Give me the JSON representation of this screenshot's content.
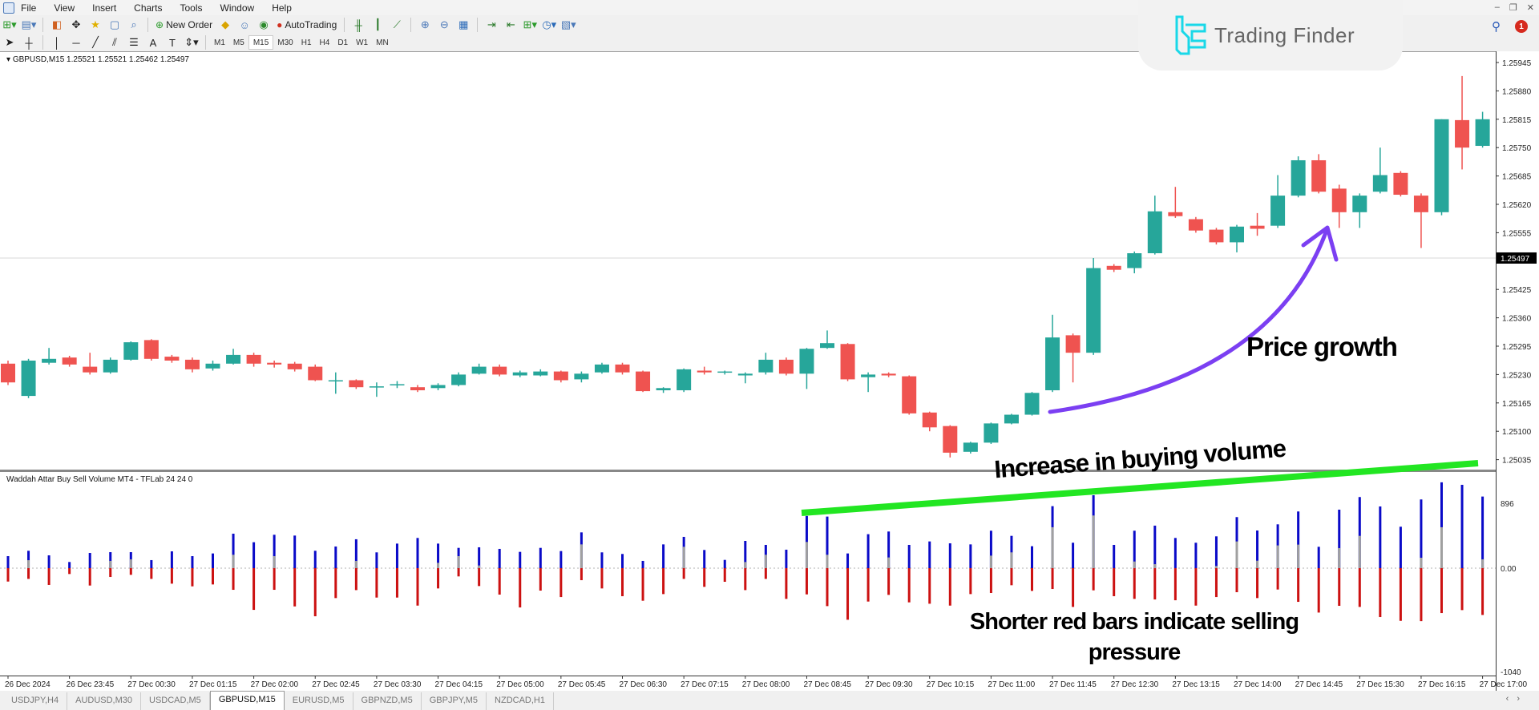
{
  "menu": [
    "File",
    "View",
    "Insert",
    "Charts",
    "Tools",
    "Window",
    "Help"
  ],
  "toolbar": {
    "new_order": "New Order",
    "autotrading": "AutoTrading",
    "timeframes": [
      "M1",
      "M5",
      "M15",
      "M30",
      "H1",
      "H4",
      "D1",
      "W1",
      "MN"
    ],
    "active_timeframe": "M15"
  },
  "logo": {
    "text": "Trading Finder"
  },
  "notifications": {
    "count": "1"
  },
  "chart": {
    "header": "GBPUSD,M15  1.25521 1.25521 1.25462 1.25497",
    "indicator_label": "Waddah Attar Buy Sell Volume MT4 - TFLab 24 24 0",
    "current_price": "1.25497",
    "price_labels": [
      "1.25945",
      "1.25880",
      "1.25815",
      "1.25750",
      "1.25685",
      "1.25620",
      "1.25555",
      "1.25425",
      "1.25360",
      "1.25295",
      "1.25230",
      "1.25165",
      "1.25100",
      "1.25035"
    ],
    "indicator_labels": {
      "max": "896",
      "zero": "0.00",
      "min": "-1040"
    },
    "time_labels": [
      "26 Dec 2024",
      "26 Dec 23:45",
      "27 Dec 00:30",
      "27 Dec 01:15",
      "27 Dec 02:00",
      "27 Dec 02:45",
      "27 Dec 03:30",
      "27 Dec 04:15",
      "27 Dec 05:00",
      "27 Dec 05:45",
      "27 Dec 06:30",
      "27 Dec 07:15",
      "27 Dec 08:00",
      "27 Dec 08:45",
      "27 Dec 09:30",
      "27 Dec 10:15",
      "27 Dec 11:00",
      "27 Dec 11:45",
      "27 Dec 12:30",
      "27 Dec 13:15",
      "27 Dec 14:00",
      "27 Dec 14:45",
      "27 Dec 15:30",
      "27 Dec 16:15",
      "27 Dec 17:00"
    ]
  },
  "annotations": {
    "buying_volume": "Increase in buying volume",
    "price_growth": "Price growth",
    "red_bars_line1": "Shorter red bars indicate selling",
    "red_bars_line2": "pressure",
    "trend_line_color": "#22e622",
    "arrow_color": "#7b3ff2"
  },
  "tabs": [
    {
      "label": "USDJPY,H4",
      "active": false
    },
    {
      "label": "AUDUSD,M30",
      "active": false
    },
    {
      "label": "USDCAD,M5",
      "active": false
    },
    {
      "label": "GBPUSD,M15",
      "active": true
    },
    {
      "label": "EURUSD,M5",
      "active": false
    },
    {
      "label": "GBPNZD,M5",
      "active": false
    },
    {
      "label": "GBPJPY,M5",
      "active": false
    },
    {
      "label": "NZDCAD,H1",
      "active": false
    }
  ],
  "chart_data": {
    "type": "candlestick",
    "symbol": "GBPUSD",
    "timeframe": "M15",
    "ylim": [
      1.25035,
      1.25945
    ],
    "colors": {
      "up": "#26a69a",
      "down": "#ef5350",
      "buy": "#0a0ac8",
      "sell": "#cc1111",
      "neutral": "#a0a0a0"
    },
    "ohlc": [
      [
        1.25255,
        1.25262,
        1.25206,
        1.25212
      ],
      [
        1.25181,
        1.25266,
        1.25176,
        1.25262
      ],
      [
        1.25257,
        1.25291,
        1.25253,
        1.25266
      ],
      [
        1.25269,
        1.25273,
        1.25248,
        1.25253
      ],
      [
        1.25248,
        1.2528,
        1.2523,
        1.25235
      ],
      [
        1.25235,
        1.25269,
        1.25232,
        1.25264
      ],
      [
        1.25264,
        1.25306,
        1.25262,
        1.25304
      ],
      [
        1.25309,
        1.25311,
        1.25262,
        1.25266
      ],
      [
        1.25271,
        1.25275,
        1.25257,
        1.25262
      ],
      [
        1.25264,
        1.25269,
        1.25235,
        1.25242
      ],
      [
        1.25244,
        1.25262,
        1.25239,
        1.25255
      ],
      [
        1.25255,
        1.25289,
        1.25253,
        1.25275
      ],
      [
        1.25275,
        1.2528,
        1.25248,
        1.25255
      ],
      [
        1.25257,
        1.25262,
        1.25246,
        1.25253
      ],
      [
        1.25255,
        1.25259,
        1.25237,
        1.25242
      ],
      [
        1.25248,
        1.25253,
        1.25215,
        1.25217
      ],
      [
        1.25215,
        1.25235,
        1.25186,
        1.25217
      ],
      [
        1.25217,
        1.25219,
        1.25197,
        1.25201
      ],
      [
        1.25201,
        1.25212,
        1.25179,
        1.25203
      ],
      [
        1.25206,
        1.25215,
        1.25199,
        1.25208
      ],
      [
        1.25201,
        1.25206,
        1.2519,
        1.25194
      ],
      [
        1.25199,
        1.2521,
        1.25194,
        1.25206
      ],
      [
        1.25206,
        1.25235,
        1.25203,
        1.2523
      ],
      [
        1.25232,
        1.25255,
        1.2523,
        1.25248
      ],
      [
        1.25248,
        1.25253,
        1.25226,
        1.2523
      ],
      [
        1.25228,
        1.25239,
        1.25224,
        1.25235
      ],
      [
        1.25228,
        1.25242,
        1.25226,
        1.25237
      ],
      [
        1.25237,
        1.25239,
        1.25212,
        1.25217
      ],
      [
        1.25219,
        1.25237,
        1.25212,
        1.25232
      ],
      [
        1.25235,
        1.25257,
        1.25232,
        1.25253
      ],
      [
        1.25253,
        1.25257,
        1.2523,
        1.25235
      ],
      [
        1.25237,
        1.25239,
        1.2519,
        1.25192
      ],
      [
        1.25194,
        1.25201,
        1.25188,
        1.25199
      ],
      [
        1.25194,
        1.25244,
        1.2519,
        1.25242
      ],
      [
        1.25239,
        1.25248,
        1.2523,
        1.25235
      ],
      [
        1.25235,
        1.25239,
        1.2523,
        1.25237
      ],
      [
        1.25228,
        1.25235,
        1.2521,
        1.25232
      ],
      [
        1.25235,
        1.2528,
        1.2523,
        1.25264
      ],
      [
        1.25264,
        1.25269,
        1.25228,
        1.25232
      ],
      [
        1.25232,
        1.25291,
        1.25197,
        1.25289
      ],
      [
        1.25291,
        1.25331,
        1.25289,
        1.25302
      ],
      [
        1.253,
        1.25302,
        1.25215,
        1.25219
      ],
      [
        1.25224,
        1.25235,
        1.2519,
        1.2523
      ],
      [
        1.25232,
        1.25235,
        1.25224,
        1.25228
      ],
      [
        1.25226,
        1.25228,
        1.25138,
        1.25141
      ],
      [
        1.25143,
        1.25145,
        1.251,
        1.25109
      ],
      [
        1.25112,
        1.25114,
        1.2504,
        1.25051
      ],
      [
        1.25053,
        1.25076,
        1.25049,
        1.25074
      ],
      [
        1.25074,
        1.2512,
        1.25071,
        1.25118
      ],
      [
        1.25118,
        1.2514,
        1.25116,
        1.25138
      ],
      [
        1.25138,
        1.2519,
        1.25136,
        1.25188
      ],
      [
        1.25194,
        1.25367,
        1.2519,
        1.25315
      ],
      [
        1.2532,
        1.25324,
        1.25212,
        1.2528
      ],
      [
        1.2528,
        1.25497,
        1.25275,
        1.25474
      ],
      [
        1.25479,
        1.25483,
        1.25465,
        1.2547
      ],
      [
        1.25474,
        1.25512,
        1.25462,
        1.25508
      ],
      [
        1.25508,
        1.2564,
        1.25505,
        1.25604
      ],
      [
        1.25602,
        1.2566,
        1.25589,
        1.25593
      ],
      [
        1.25586,
        1.25591,
        1.25555,
        1.2556
      ],
      [
        1.25562,
        1.25566,
        1.25528,
        1.25533
      ],
      [
        1.25533,
        1.25573,
        1.2551,
        1.25569
      ],
      [
        1.25571,
        1.256,
        1.25548,
        1.25564
      ],
      [
        1.25571,
        1.25687,
        1.25566,
        1.2564
      ],
      [
        1.2564,
        1.2573,
        1.25636,
        1.25721
      ],
      [
        1.25721,
        1.25735,
        1.25645,
        1.25649
      ],
      [
        1.25656,
        1.25665,
        1.25566,
        1.25602
      ],
      [
        1.25602,
        1.25645,
        1.25566,
        1.2564
      ],
      [
        1.25649,
        1.2575,
        1.25645,
        1.25687
      ],
      [
        1.25692,
        1.25696,
        1.25638,
        1.25642
      ],
      [
        1.2564,
        1.25645,
        1.2552,
        1.25602
      ],
      [
        1.25602,
        1.25815,
        1.25595,
        1.25815
      ],
      [
        1.25813,
        1.25914,
        1.257,
        1.2575
      ],
      [
        1.25754,
        1.25832,
        1.2575,
        1.25815
      ]
    ],
    "volume": {
      "buy": [
        166,
        240,
        177,
        85,
        210,
        221,
        221,
        111,
        232,
        166,
        203,
        476,
        358,
        461,
        450,
        240,
        299,
        399,
        218,
        339,
        417,
        339,
        280,
        288,
        266,
        225,
        280,
        236,
        494,
        218,
        196,
        100,
        328,
        432,
        251,
        114,
        376,
        321,
        255,
        720,
        712,
        203,
        469,
        506,
        321,
        369,
        343,
        328,
        517,
        446,
        303,
        856,
        351,
        1007,
        321,
        517,
        587,
        417,
        351,
        439,
        705,
        520,
        605,
        782,
        295,
        808,
        982,
        852,
        572,
        948,
        1185,
        1151,
        989
      ],
      "neutral": [
        0,
        110,
        0,
        0,
        0,
        100,
        122,
        0,
        0,
        0,
        0,
        185,
        0,
        166,
        0,
        0,
        0,
        100,
        0,
        0,
        0,
        74,
        166,
        37,
        0,
        0,
        0,
        0,
        328,
        0,
        0,
        0,
        0,
        295,
        0,
        0,
        85,
        185,
        0,
        362,
        185,
        0,
        0,
        148,
        0,
        0,
        0,
        0,
        173,
        218,
        0,
        565,
        0,
        727,
        0,
        92,
        55,
        0,
        0,
        30,
        369,
        103,
        314,
        325,
        0,
        277,
        446,
        0,
        0,
        144,
        565,
        0,
        122
      ],
      "sell": [
        185,
        148,
        232,
        81,
        240,
        122,
        92,
        148,
        214,
        251,
        225,
        299,
        576,
        299,
        528,
        664,
        413,
        303,
        406,
        406,
        517,
        280,
        114,
        247,
        365,
        542,
        310,
        399,
        166,
        280,
        387,
        450,
        358,
        148,
        258,
        188,
        303,
        148,
        424,
        362,
        524,
        712,
        461,
        369,
        472,
        491,
        517,
        358,
        343,
        236,
        314,
        288,
        535,
        306,
        387,
        424,
        432,
        443,
        517,
        399,
        332,
        413,
        295,
        465,
        613,
        520,
        535,
        675,
        727,
        731,
        620,
        579,
        646
      ]
    }
  }
}
